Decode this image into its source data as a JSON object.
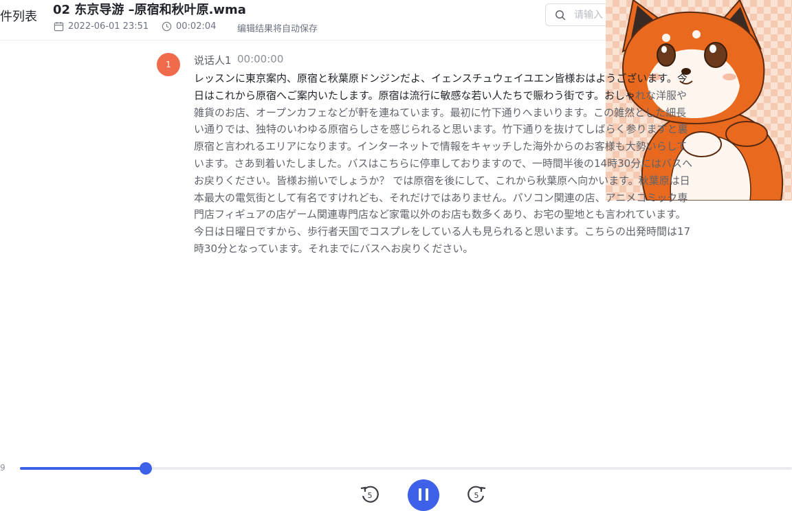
{
  "header": {
    "back_label": "件列表",
    "file_title": "02 东京导游 –原宿和秋叶原.wma",
    "date": "2022-06-01 23:51",
    "duration": "00:02:04",
    "autosave_note": "编辑结果将自动保存"
  },
  "search": {
    "placeholder": "请输入"
  },
  "transcript": {
    "speaker_number": "1",
    "speaker_name": "说话人1",
    "start_time": "00:00:00",
    "played_text": "レッスンに東京案内、原宿と秋葉原ドンジンだよ、イェンスチュウェイユエン皆様おはようございます。今日はこれから原宿へご案内いたします。原宿は流行に敏感な若い人たちで賑わう街です。おしゃ",
    "pending_text": "れな洋服や雑貨のお店、オープンカフェなどが軒を連ねています。最初に竹下通りへまいります。この雑然とした細長い通りでは、独特のいわゆる原宿らしさを感じられると思います。竹下通りを抜けてしばらく参りますと裏原宿と言われるエリアになります。インターネットで情報をキャッチした海外からのお客様も大勢いらしています。さあ到着いたしました。バスはこちらに停車しておりますので、一時間半後の14時30分にはバスへお戻りください。皆様お揃いでしょうか？ では原宿を後にして、これから秋葉原へ向かいます。秋葉原は日本最大の電気街として有名ですけれども、それだけではありません。パソコン関連の店、アニメコミック専門店フィギュアの店ゲーム関連専門店など家電以外のお店も数多くあり、お宅の聖地とも言われています。今日は日曜日ですから、歩行者天国でコスプレをしている人も見られると思います。こちらの出発時間は17時30分となっています。それまでにバスへお戻りください。"
  },
  "player": {
    "current_time": "9",
    "progress": 0.163
  },
  "colors": {
    "accent": "#3d61e8",
    "speaker_badge": "#f06a4c"
  },
  "icons": [
    "calendar-icon",
    "clock-icon",
    "search-icon",
    "rewind-5-icon",
    "pause-icon",
    "forward-5-icon",
    "mascot-fox-sticker"
  ]
}
